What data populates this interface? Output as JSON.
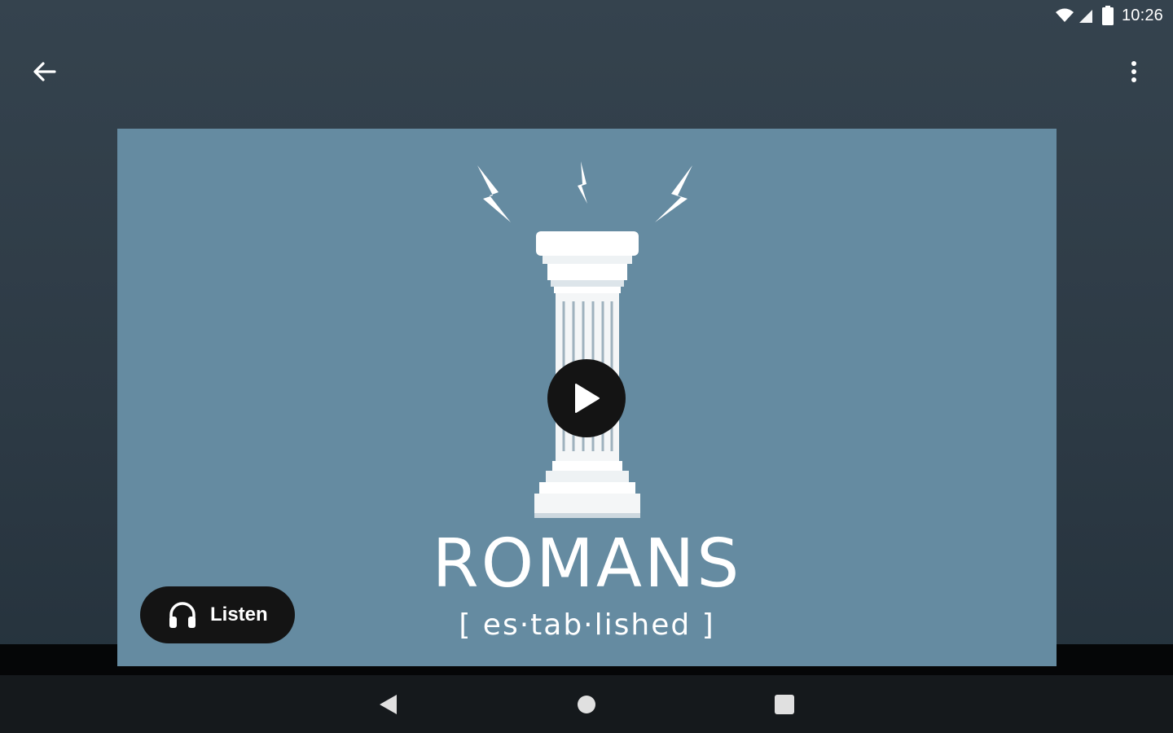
{
  "status_bar": {
    "time": "10:26",
    "icons": [
      "wifi-icon",
      "cell-signal-icon",
      "battery-icon"
    ]
  },
  "app_bar": {
    "back_icon": "back-arrow-icon",
    "menu_icon": "more-vert-icon"
  },
  "media": {
    "title": "ROMANS",
    "subtitle": "[ es·tab·lished ]",
    "background_color": "#658ba1",
    "play_icon": "play-icon",
    "listen_label": "Listen",
    "listen_icon": "headphones-icon"
  },
  "nav_bar": {
    "icons": [
      "nav-back-icon",
      "nav-home-icon",
      "nav-recents-icon"
    ]
  }
}
